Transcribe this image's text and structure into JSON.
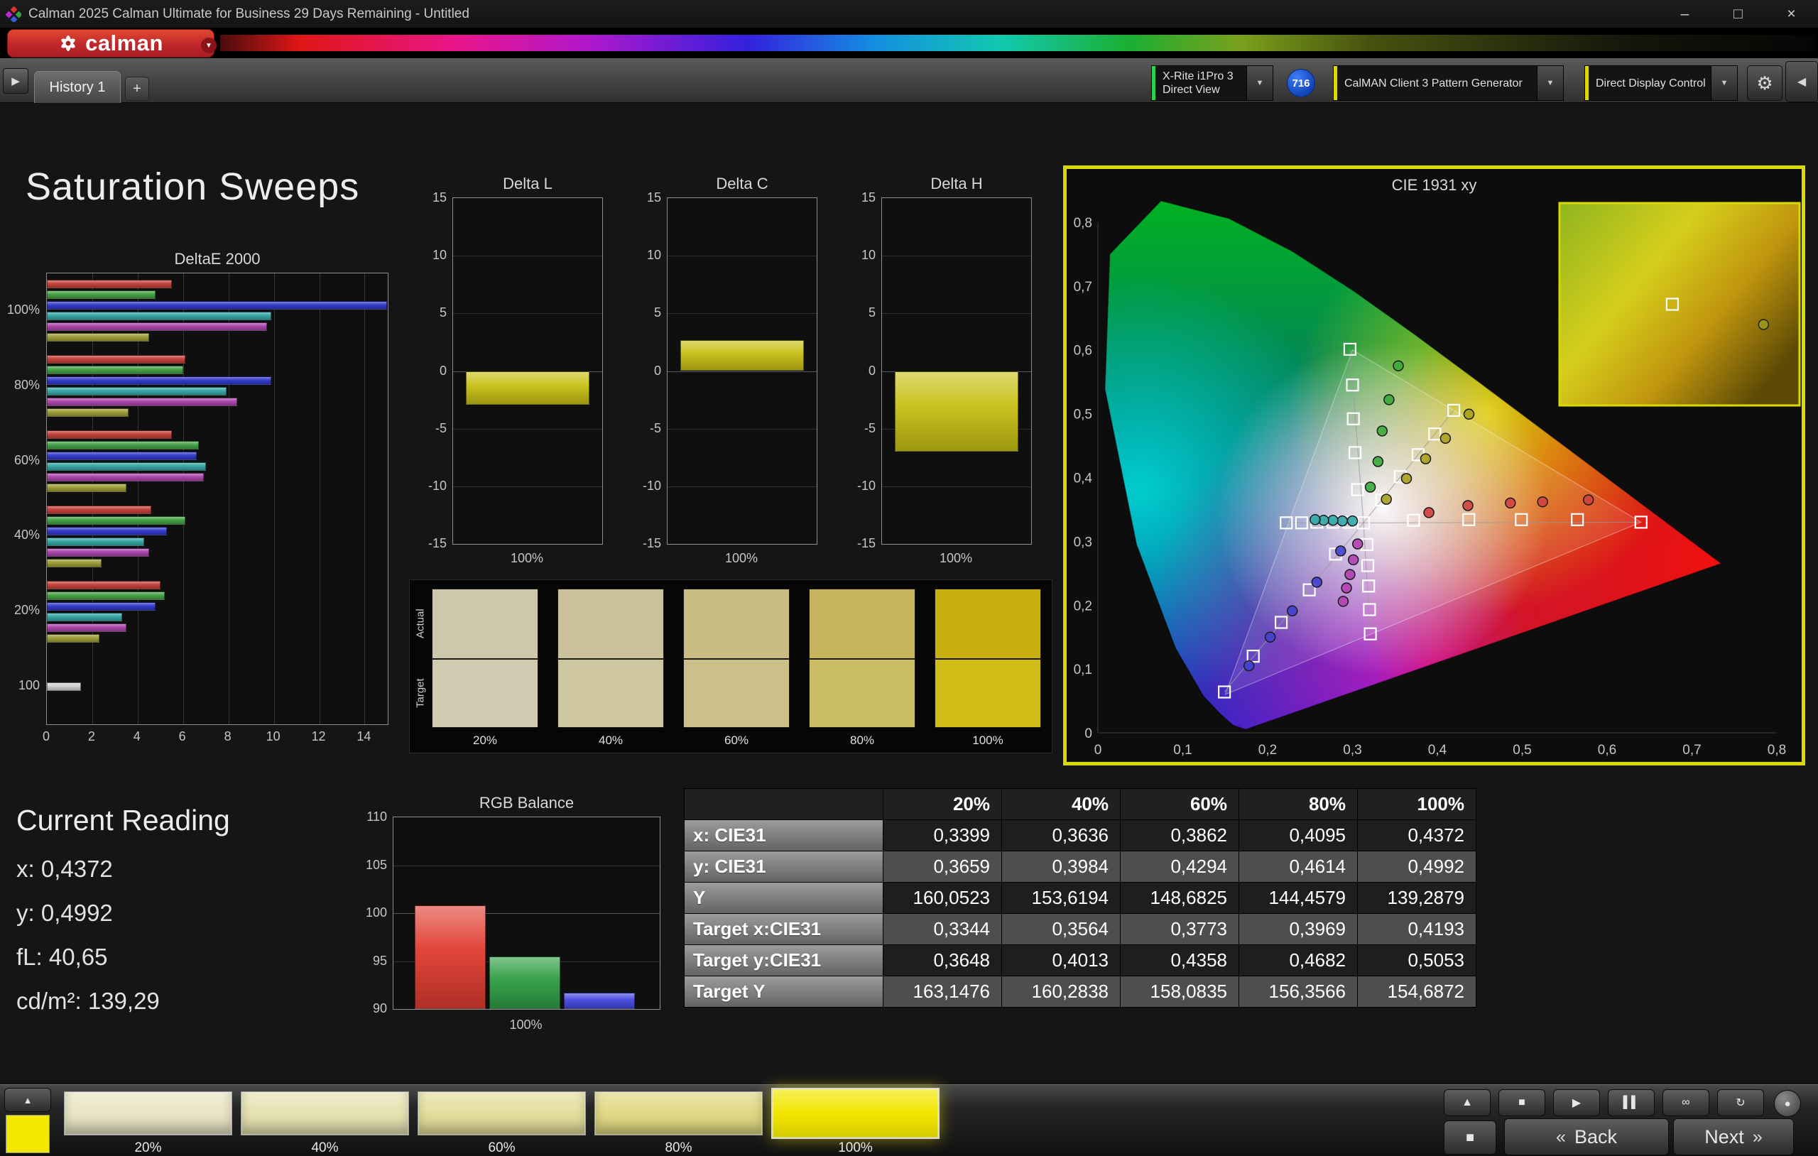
{
  "window": {
    "title": "Calman 2025 Calman Ultimate for Business 29 Days Remaining  - Untitled",
    "controls": {
      "minimize": "–",
      "maximize": "□",
      "close": "×"
    }
  },
  "brand": {
    "logo_text": "calman",
    "dropdown_icon": "▼"
  },
  "tab_bar": {
    "nav_icon": "▶",
    "tabs": [
      {
        "label": "History 1"
      }
    ],
    "add_label": "+"
  },
  "toolbar": {
    "meter": {
      "line1": "X-Rite i1Pro 3",
      "line2": "Direct View",
      "accent": "#2fd24a",
      "dropdown_icon": "▼"
    },
    "badge": "716",
    "pattern_generator": {
      "label": "CalMAN Client 3 Pattern Generator",
      "accent": "#d9d900",
      "dropdown_icon": "▼"
    },
    "display_control": {
      "label": "Direct Display Control",
      "accent": "#d9d900",
      "dropdown_icon": "▼"
    },
    "gear_icon": "⚙",
    "collapse_icon": "◀"
  },
  "main": {
    "title": "Saturation Sweeps"
  },
  "current_reading": {
    "title": "Current Reading",
    "items": [
      "x: 0,4372",
      "y: 0,4992",
      "fL: 40,65",
      "cd/m²: 139,29"
    ]
  },
  "swatch_strip": {
    "row_labels": [
      "Actual",
      "Target"
    ],
    "columns": [
      {
        "label": "20%",
        "actual": "#cdc7ac",
        "target": "#d0cab0"
      },
      {
        "label": "40%",
        "actual": "#cbc29a",
        "target": "#cec69e"
      },
      {
        "label": "60%",
        "actual": "#c9bc82",
        "target": "#ccc08a"
      },
      {
        "label": "80%",
        "actual": "#c6b55c",
        "target": "#cabc64"
      },
      {
        "label": "100%",
        "actual": "#c9ae12",
        "target": "#d0bd18"
      }
    ]
  },
  "chart_data": [
    {
      "type": "bar",
      "orientation": "horizontal",
      "title": "DeltaE 2000",
      "xlim": [
        0,
        15
      ],
      "xticks": [
        0,
        2,
        4,
        6,
        8,
        10,
        12,
        14
      ],
      "grid": true,
      "categories": [
        "100%",
        "80%",
        "60%",
        "40%",
        "20%",
        "100"
      ],
      "series_names": [
        "red",
        "green",
        "blue",
        "cyan",
        "magenta",
        "yellow"
      ],
      "series_colors": [
        "#c23b34",
        "#3f9e3f",
        "#2b34c8",
        "#2fa3a3",
        "#a83fa8",
        "#9a9a30"
      ],
      "groups": [
        {
          "label": "100%",
          "values": [
            5.5,
            4.8,
            15.0,
            9.9,
            9.7,
            4.5
          ]
        },
        {
          "label": "80%",
          "values": [
            6.1,
            6.0,
            9.9,
            7.9,
            8.4,
            3.6
          ]
        },
        {
          "label": "60%",
          "values": [
            5.5,
            6.7,
            6.6,
            7.0,
            6.9,
            3.5
          ]
        },
        {
          "label": "40%",
          "values": [
            4.6,
            6.1,
            5.3,
            4.3,
            4.5,
            2.4
          ]
        },
        {
          "label": "20%",
          "values": [
            5.0,
            5.2,
            4.8,
            3.3,
            3.5,
            2.3
          ]
        },
        {
          "label": "100",
          "values": [
            1.5
          ],
          "colors": [
            "#cfcfcf"
          ]
        }
      ]
    },
    {
      "type": "bar",
      "title": "Delta L",
      "categories": [
        "100%"
      ],
      "values": [
        -2.9
      ],
      "ylim": [
        -15,
        15
      ],
      "yticks": [
        15,
        10,
        5,
        0,
        -5,
        -10,
        -15
      ],
      "bar_color": "#c8c014"
    },
    {
      "type": "bar",
      "title": "Delta C",
      "categories": [
        "100%"
      ],
      "values": [
        2.7
      ],
      "ylim": [
        -15,
        15
      ],
      "yticks": [
        15,
        10,
        5,
        0,
        -5,
        -10,
        -15
      ],
      "bar_color": "#c8c014"
    },
    {
      "type": "bar",
      "title": "Delta H",
      "categories": [
        "100%"
      ],
      "values": [
        -7.0
      ],
      "ylim": [
        -15,
        15
      ],
      "yticks": [
        15,
        10,
        5,
        0,
        -5,
        -10,
        -15
      ],
      "bar_color": "#c8c014"
    },
    {
      "type": "bar",
      "title": "RGB Balance",
      "categories": [
        "100%"
      ],
      "ylim": [
        90,
        110
      ],
      "yticks": [
        110,
        105,
        100,
        95,
        90
      ],
      "series": [
        {
          "name": "Red",
          "color": "#e03c30",
          "value": 100.8
        },
        {
          "name": "Green",
          "color": "#2f9e44",
          "value": 95.5
        },
        {
          "name": "Blue",
          "color": "#4446df",
          "value": 91.7
        }
      ]
    },
    {
      "type": "scatter",
      "title": "CIE 1931 xy",
      "xlim": [
        0,
        0.8
      ],
      "ylim": [
        0,
        0.8
      ],
      "xtick_labels": [
        "0",
        "0,1",
        "0,2",
        "0,3",
        "0,4",
        "0,5",
        "0,6",
        "0,7",
        "0,8"
      ],
      "ytick_labels": [
        "0",
        "0,1",
        "0,2",
        "0,3",
        "0,4",
        "0,5",
        "0,6",
        "0,7",
        "0,8"
      ],
      "white_point": [
        0.313,
        0.329
      ],
      "gamut_triangle": [
        [
          0.64,
          0.33
        ],
        [
          0.3,
          0.6
        ],
        [
          0.15,
          0.06
        ]
      ],
      "inset": {
        "border_color": "#d9d900",
        "marker_square_frac": [
          0.47,
          0.5
        ],
        "marker_circle_frac": [
          0.85,
          0.6
        ]
      },
      "series": [
        {
          "name": "red",
          "color": "#d04040",
          "targets": [
            [
              0.372,
              0.333
            ],
            [
              0.437,
              0.334
            ],
            [
              0.499,
              0.334
            ],
            [
              0.565,
              0.334
            ],
            [
              0.64,
              0.33
            ]
          ],
          "measured": [
            [
              0.39,
              0.345
            ],
            [
              0.436,
              0.356
            ],
            [
              0.486,
              0.36
            ],
            [
              0.524,
              0.362
            ],
            [
              0.578,
              0.365
            ]
          ]
        },
        {
          "name": "green",
          "color": "#3aa83a",
          "targets": [
            [
              0.306,
              0.381
            ],
            [
              0.303,
              0.439
            ],
            [
              0.301,
              0.492
            ],
            [
              0.3,
              0.545
            ],
            [
              0.297,
              0.601
            ]
          ],
          "measured": [
            [
              0.321,
              0.385
            ],
            [
              0.33,
              0.425
            ],
            [
              0.335,
              0.473
            ],
            [
              0.343,
              0.522
            ],
            [
              0.354,
              0.575
            ]
          ]
        },
        {
          "name": "blue",
          "color": "#4040d0",
          "targets": [
            [
              0.28,
              0.28
            ],
            [
              0.249,
              0.224
            ],
            [
              0.216,
              0.173
            ],
            [
              0.183,
              0.12
            ],
            [
              0.149,
              0.064
            ]
          ],
          "measured": [
            [
              0.286,
              0.285
            ],
            [
              0.258,
              0.236
            ],
            [
              0.229,
              0.191
            ],
            [
              0.203,
              0.15
            ],
            [
              0.178,
              0.105
            ]
          ]
        },
        {
          "name": "cyan",
          "color": "#30a8a8",
          "targets": [
            [
              0.296,
              0.33
            ],
            [
              0.277,
              0.33
            ],
            [
              0.258,
              0.33
            ],
            [
              0.24,
              0.329
            ],
            [
              0.222,
              0.329
            ]
          ],
          "measured": [
            [
              0.3,
              0.332
            ],
            [
              0.288,
              0.332
            ],
            [
              0.277,
              0.333
            ],
            [
              0.266,
              0.333
            ],
            [
              0.256,
              0.334
            ]
          ]
        },
        {
          "name": "magenta",
          "color": "#b040b0",
          "targets": [
            [
              0.317,
              0.295
            ],
            [
              0.318,
              0.262
            ],
            [
              0.319,
              0.23
            ],
            [
              0.32,
              0.193
            ],
            [
              0.321,
              0.155
            ]
          ],
          "measured": [
            [
              0.306,
              0.296
            ],
            [
              0.301,
              0.271
            ],
            [
              0.297,
              0.248
            ],
            [
              0.293,
              0.227
            ],
            [
              0.289,
              0.206
            ]
          ]
        },
        {
          "name": "yellow",
          "color": "#a8a020",
          "targets": [
            [
              0.3344,
              0.3648
            ],
            [
              0.3564,
              0.4013
            ],
            [
              0.3773,
              0.4358
            ],
            [
              0.3969,
              0.4682
            ],
            [
              0.4193,
              0.5053
            ]
          ],
          "measured": [
            [
              0.3399,
              0.3659
            ],
            [
              0.3636,
              0.3984
            ],
            [
              0.3862,
              0.4294
            ],
            [
              0.4095,
              0.4614
            ],
            [
              0.4372,
              0.4992
            ]
          ]
        }
      ]
    },
    {
      "type": "table",
      "headers": [
        "",
        "20%",
        "40%",
        "60%",
        "80%",
        "100%"
      ],
      "rows": [
        [
          "x: CIE31",
          "0,3399",
          "0,3636",
          "0,3862",
          "0,4095",
          "0,4372"
        ],
        [
          "y: CIE31",
          "0,3659",
          "0,3984",
          "0,4294",
          "0,4614",
          "0,4992"
        ],
        [
          "Y",
          "160,0523",
          "153,6194",
          "148,6825",
          "144,4579",
          "139,2879"
        ],
        [
          "Target x:CIE31",
          "0,3344",
          "0,3564",
          "0,3773",
          "0,3969",
          "0,4193"
        ],
        [
          "Target y:CIE31",
          "0,3648",
          "0,4013",
          "0,4358",
          "0,4682",
          "0,5053"
        ],
        [
          "Target Y",
          "163,1476",
          "160,2838",
          "158,0835",
          "156,3566",
          "154,6872"
        ]
      ]
    }
  ],
  "bottom_bar": {
    "indicator_color": "#f2e800",
    "handle_icon": "▲",
    "swatches": [
      {
        "label": "20%",
        "color": "#e9e5c4"
      },
      {
        "label": "40%",
        "color": "#e7e2b2"
      },
      {
        "label": "60%",
        "color": "#e4de9c"
      },
      {
        "label": "80%",
        "color": "#e1d984"
      },
      {
        "label": "100%",
        "color": "#f2e600",
        "selected": true
      }
    ],
    "controls": [
      {
        "name": "eject",
        "icon": "▲"
      },
      {
        "name": "stop",
        "icon": "■"
      },
      {
        "name": "play",
        "icon": "▶"
      },
      {
        "name": "pause",
        "icon": "▌▌"
      },
      {
        "name": "loop",
        "icon": "∞"
      },
      {
        "name": "refresh",
        "icon": "↻"
      }
    ],
    "record_icon": "●",
    "stop_icon": "■",
    "back": {
      "chevron": "«",
      "label": "Back"
    },
    "next": {
      "label": "Next",
      "chevron": "»"
    }
  }
}
